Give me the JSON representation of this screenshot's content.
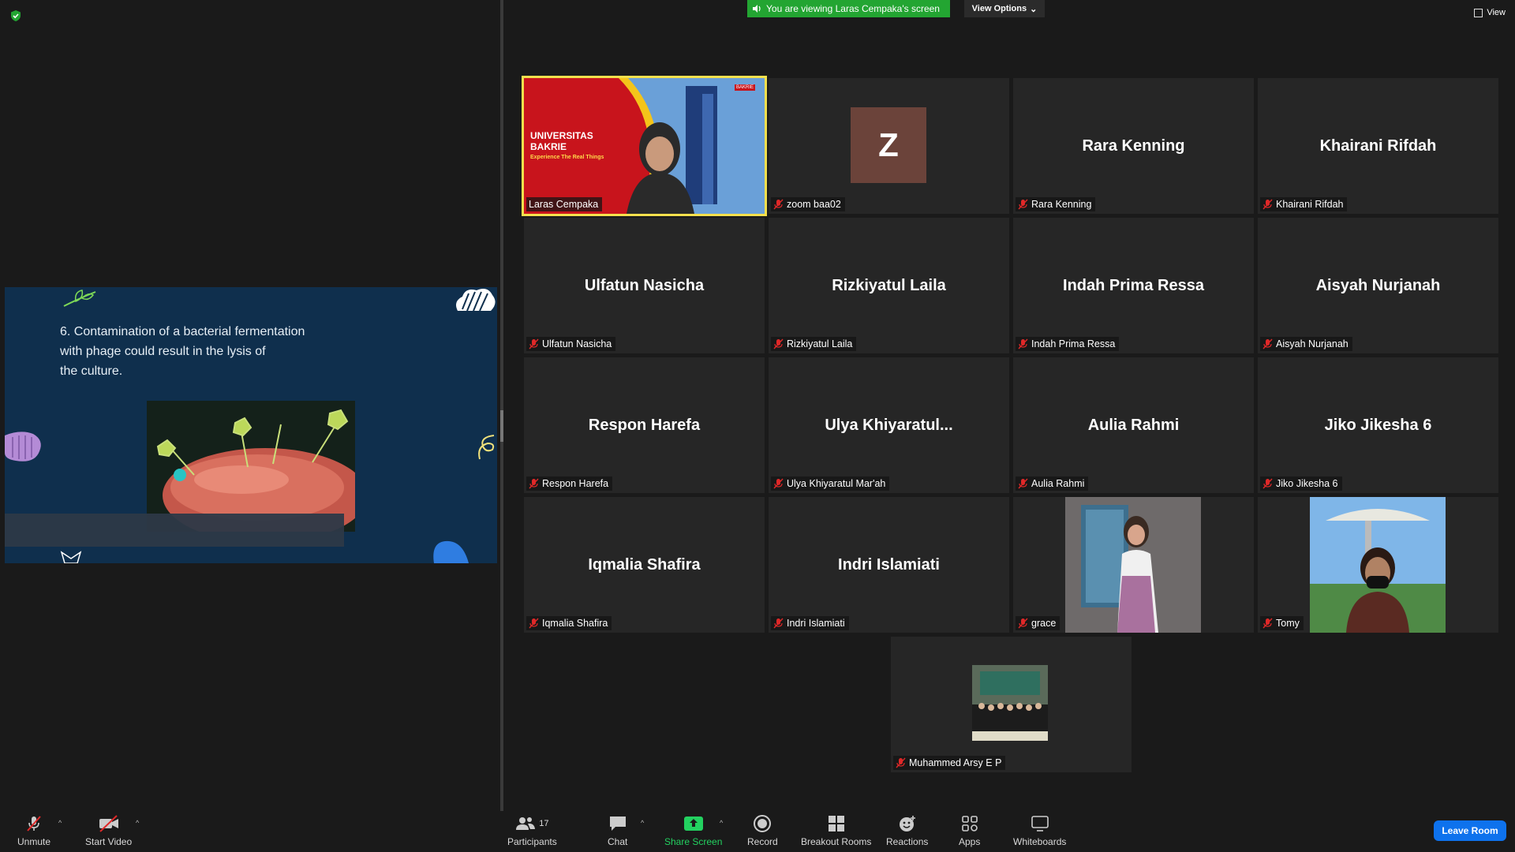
{
  "banner": {
    "viewing_text": "You are viewing Laras Cempaka's screen",
    "view_options": "View Options",
    "view": "View"
  },
  "slide": {
    "line1": "6. Contamination of a bacterial fermentation",
    "line2": "with phage could result in the lysis of",
    "line3": "the culture."
  },
  "shared_tile": {
    "university_line1": "UNIVERSITAS",
    "university_line2": "BAKRIE",
    "tagline": "Experience The Real Things",
    "logo_text": "BAKRIE"
  },
  "tiles": [
    {
      "center": "",
      "label": "Laras Cempaka"
    },
    {
      "center": "Z",
      "label": "zoom baa02"
    },
    {
      "center": "Rara Kenning",
      "label": "Rara Kenning"
    },
    {
      "center": "Khairani Rifdah",
      "label": "Khairani Rifdah"
    },
    {
      "center": "Ulfatun Nasicha",
      "label": "Ulfatun Nasicha"
    },
    {
      "center": "Rizkiyatul Laila",
      "label": "Rizkiyatul Laila"
    },
    {
      "center": "Indah Prima Ressa",
      "label": "Indah Prima Ressa"
    },
    {
      "center": "Aisyah Nurjanah",
      "label": "Aisyah Nurjanah"
    },
    {
      "center": "Respon Harefa",
      "label": "Respon Harefa"
    },
    {
      "center": "Ulya  Khiyaratul...",
      "label": "Ulya Khiyaratul Mar'ah"
    },
    {
      "center": "Aulia Rahmi",
      "label": "Aulia Rahmi"
    },
    {
      "center": "Jiko Jikesha 6",
      "label": "Jiko Jikesha 6"
    },
    {
      "center": "Iqmalia Shafira",
      "label": "Iqmalia Shafira"
    },
    {
      "center": "Indri Islamiati",
      "label": "Indri Islamiati"
    },
    {
      "center": "",
      "label": "grace"
    },
    {
      "center": "",
      "label": "Tomy"
    },
    {
      "center": "",
      "label": "Muhammed Arsy E P"
    }
  ],
  "toolbar": {
    "unmute": "Unmute",
    "start_video": "Start Video",
    "participants": "Participants",
    "participants_count": "17",
    "chat": "Chat",
    "share_screen": "Share Screen",
    "record": "Record",
    "breakout_rooms": "Breakout Rooms",
    "reactions": "Reactions",
    "apps": "Apps",
    "whiteboards": "Whiteboards",
    "leave_room": "Leave Room"
  },
  "colors": {
    "banner_green": "#23a532",
    "active_speaker": "#f4e04d",
    "leave_blue": "#0e72ed",
    "avatar_z": "#6b433a",
    "mic_off_red": "#e02828"
  }
}
